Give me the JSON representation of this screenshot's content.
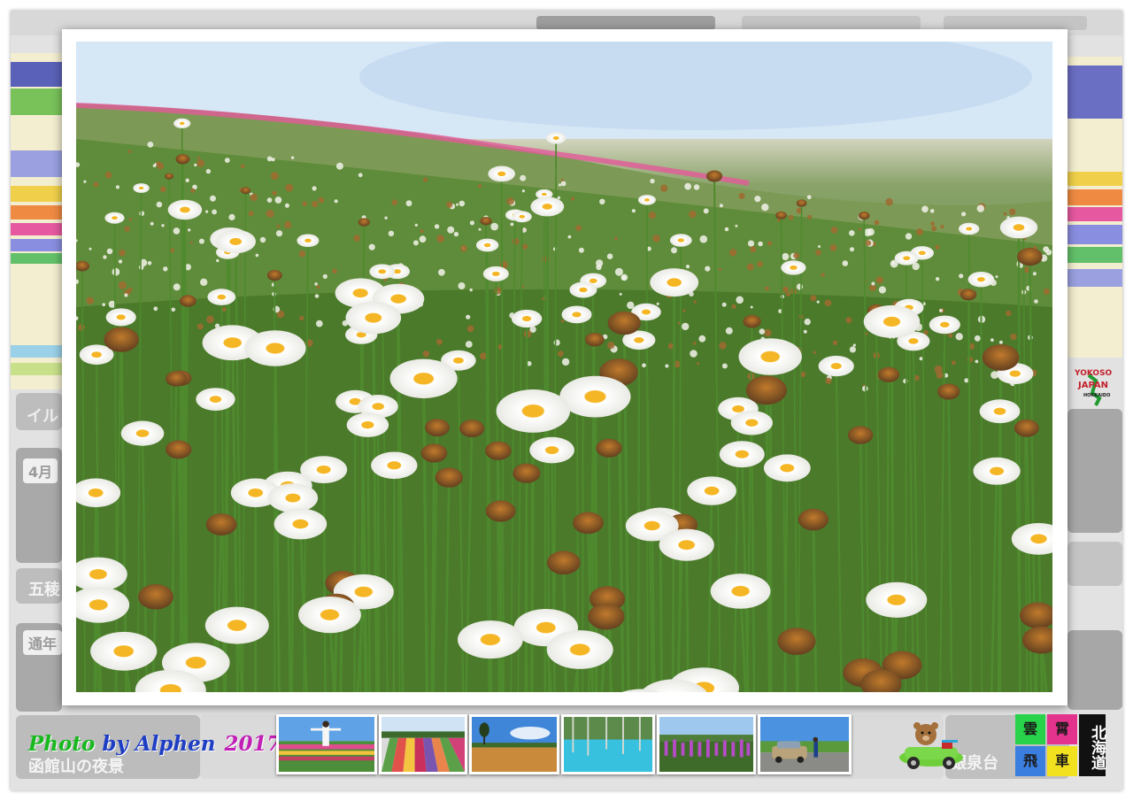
{
  "watermark": {
    "part1": "Photo",
    "part2": " by Alphen",
    "year": "2017"
  },
  "thumbnails": [
    {
      "name": "thumb-person-flower-field"
    },
    {
      "name": "thumb-striped-flower-fields"
    },
    {
      "name": "thumb-lone-tree-wheat-field"
    },
    {
      "name": "thumb-blue-pond"
    },
    {
      "name": "thumb-lupine-field"
    },
    {
      "name": "thumb-car-roadside"
    }
  ],
  "background": {
    "labels": [
      "4月",
      "五稜",
      "函館山の夜景",
      "通年",
      "銀泉台",
      "イル"
    ]
  },
  "logo": {
    "cells": [
      "雲",
      "霄",
      "飛",
      "車"
    ],
    "side": "北海道",
    "colors": [
      "#28d24b",
      "#e4338d",
      "#3a7ee0",
      "#f1e11f"
    ]
  },
  "brand": {
    "word1": "YOKOSO",
    "word2": "JAPAN",
    "word3": "HOKKAIDO"
  }
}
